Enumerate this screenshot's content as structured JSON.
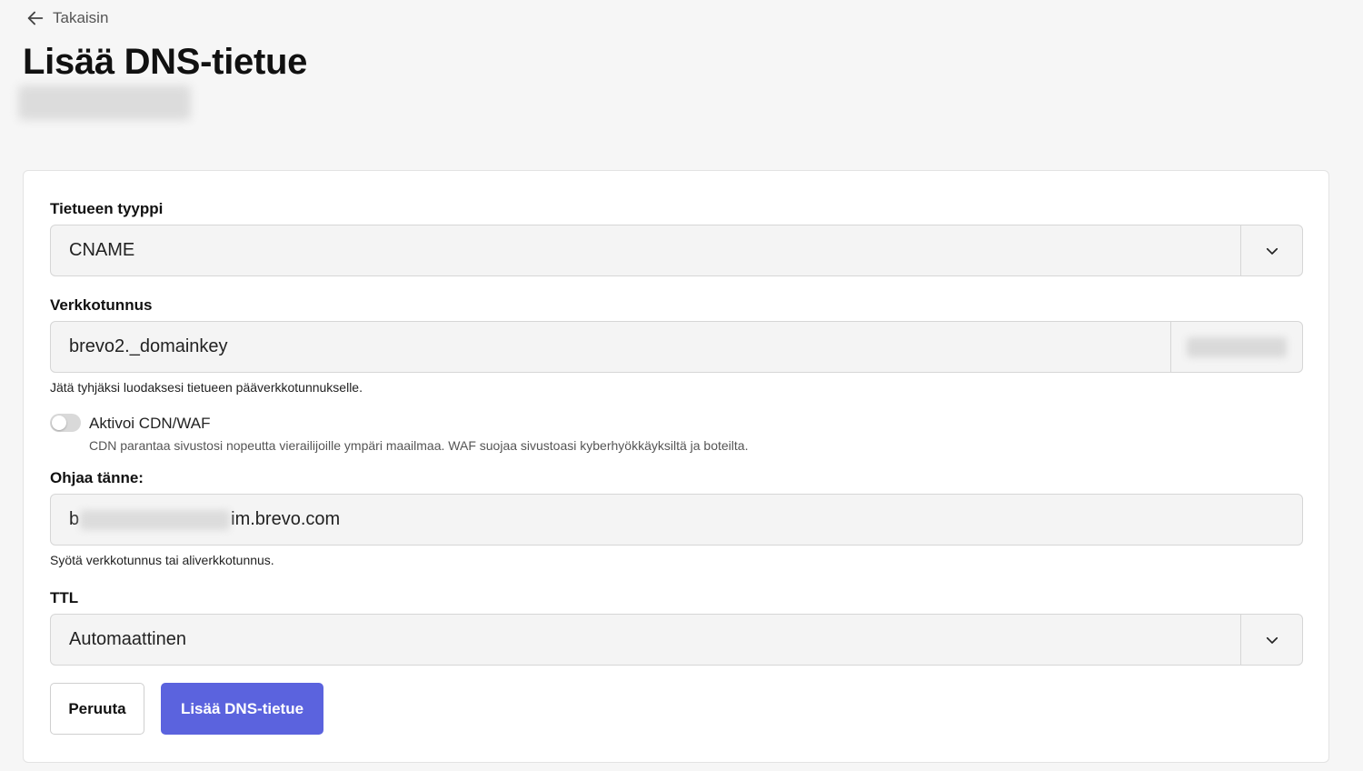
{
  "nav": {
    "back_label": "Takaisin"
  },
  "page": {
    "title": "Lisää DNS-tietue"
  },
  "form": {
    "record_type": {
      "label": "Tietueen tyyppi",
      "value": "CNAME"
    },
    "domain": {
      "label": "Verkkotunnus",
      "value": "brevo2._domainkey",
      "hint": "Jätä tyhjäksi luodaksesi tietueen pääverkkotunnukselle."
    },
    "cdn": {
      "label": "Aktivoi CDN/WAF",
      "description": "CDN parantaa sivustosi nopeutta vierailijoille ympäri maailmaa. WAF suojaa sivustoasi kyberhyökkäyksiltä ja boteilta.",
      "enabled": false
    },
    "target": {
      "label": "Ohjaa tänne:",
      "value_prefix": "b",
      "value_suffix": "im.brevo.com",
      "hint": "Syötä verkkotunnus tai aliverkkotunnus."
    },
    "ttl": {
      "label": "TTL",
      "value": "Automaattinen"
    }
  },
  "actions": {
    "cancel_label": "Peruuta",
    "submit_label": "Lisää DNS-tietue"
  },
  "colors": {
    "primary": "#5b63de",
    "background": "#f6f6f6"
  },
  "icons": {
    "back": "arrow-left-icon",
    "dropdown": "chevron-down-icon"
  }
}
